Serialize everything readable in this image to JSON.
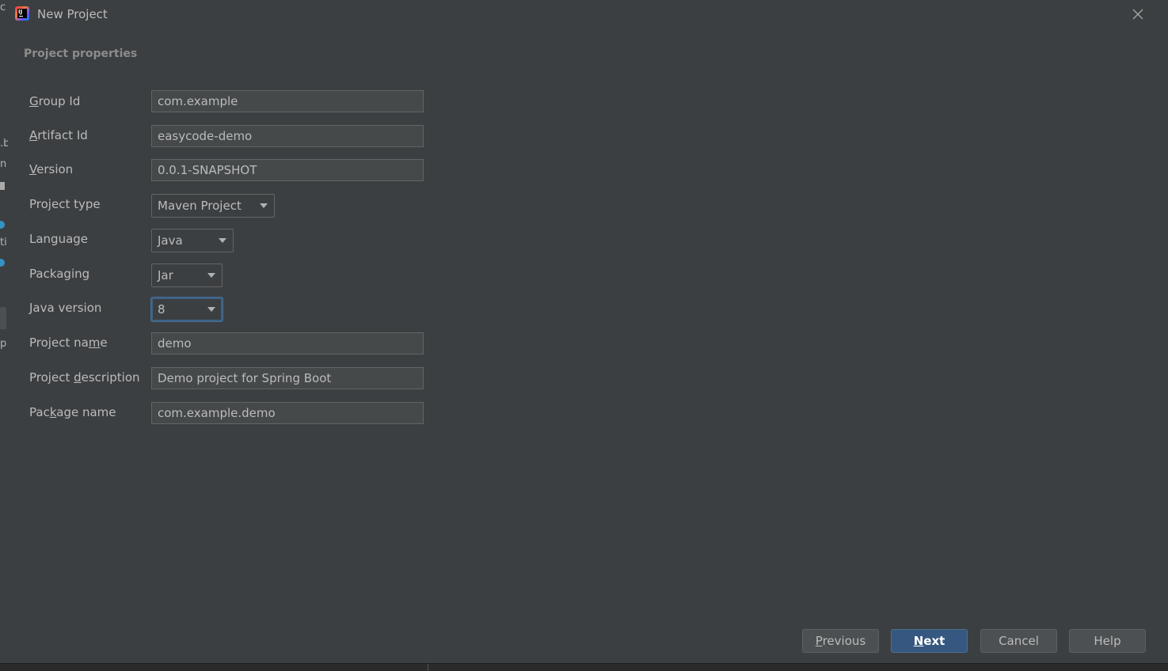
{
  "window": {
    "title": "New Project"
  },
  "section": {
    "title": "Project properties"
  },
  "form": {
    "group_id": {
      "label_mnemonic": "G",
      "label_rest": "roup Id",
      "value": "com.example"
    },
    "artifact_id": {
      "label_mnemonic": "A",
      "label_rest": "rtifact Id",
      "value": "easycode-demo"
    },
    "version": {
      "label_mnemonic": "V",
      "label_rest": "ersion",
      "value": "0.0.1-SNAPSHOT"
    },
    "project_type": {
      "label": "Project type",
      "value": "Maven Project"
    },
    "language": {
      "label": "Language",
      "value": "Java"
    },
    "packaging": {
      "label": "Packaging",
      "value": "Jar"
    },
    "java_version": {
      "label": "Java version",
      "value": "8"
    },
    "project_name": {
      "label_pre": "Project na",
      "label_mnemonic": "m",
      "label_post": "e",
      "value": "demo"
    },
    "project_description": {
      "label_pre": "Project ",
      "label_mnemonic": "d",
      "label_post": "escription",
      "value": "Demo project for Spring Boot"
    },
    "package_name": {
      "label_pre": "Pac",
      "label_mnemonic": "k",
      "label_post": "age name",
      "value": "com.example.demo"
    }
  },
  "buttons": {
    "previous": {
      "mnemonic": "P",
      "rest": "revious"
    },
    "next": {
      "mnemonic": "N",
      "rest": "ext"
    },
    "cancel": "Cancel",
    "help": "Help"
  },
  "background": {
    "left_fragments": [
      "c",
      ".b",
      "n",
      "ti",
      "p"
    ]
  },
  "colors": {
    "dialog_bg": "#3c3f41",
    "field_bg": "#45494a",
    "default_button": "#365880",
    "focus_border": "#3d6185",
    "text": "#bbbbbb"
  }
}
